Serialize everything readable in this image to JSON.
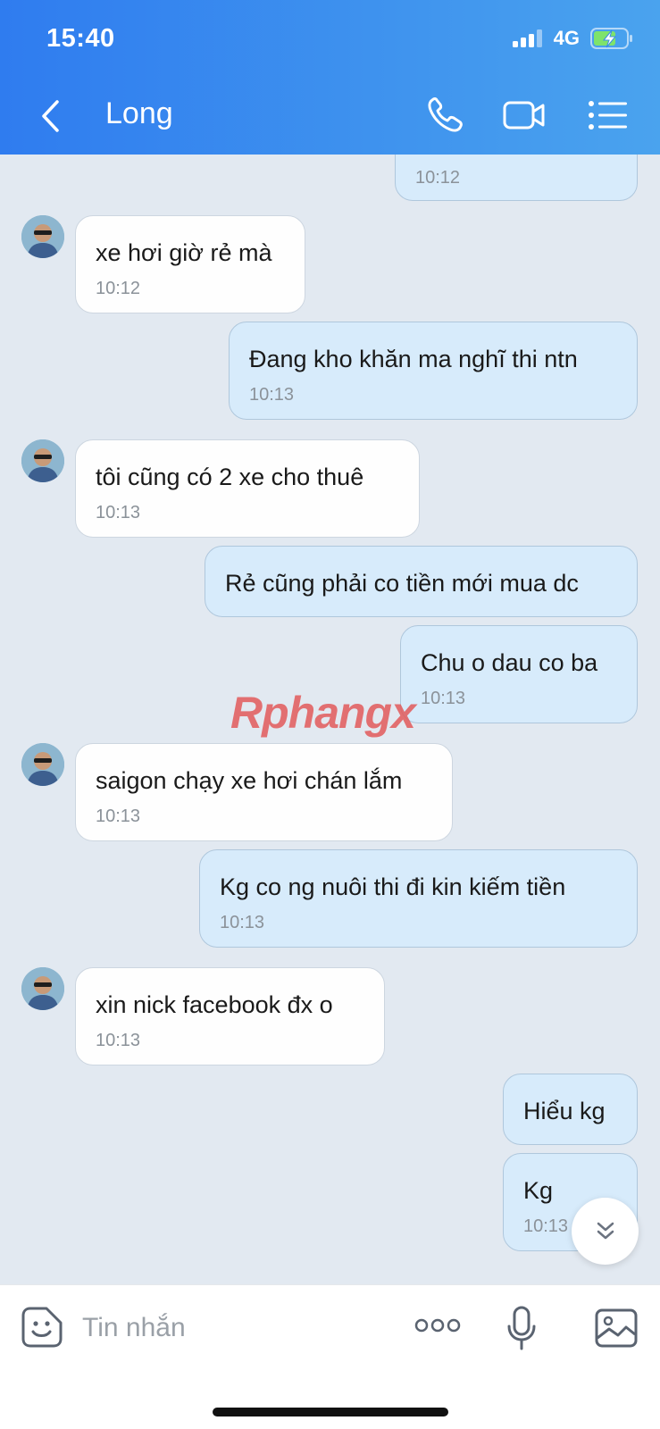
{
  "status_bar": {
    "time": "15:40",
    "network": "4G",
    "battery_icon": "battery-charging-icon",
    "signal_icon": "signal-bars-icon"
  },
  "header": {
    "title": "Long",
    "back_icon": "chevron-left-icon",
    "call_icon": "phone-icon",
    "video_icon": "video-camera-icon",
    "menu_icon": "list-menu-icon",
    "gradient_start": "#2f7cef",
    "gradient_end": "#4aa3ee"
  },
  "messages": [
    {
      "direction": "out",
      "text": "",
      "time": "10:12"
    },
    {
      "direction": "in",
      "text": "xe hơi giờ rẻ mà",
      "time": "10:12"
    },
    {
      "direction": "out",
      "text": "Đang kho khăn ma nghĩ thi ntn",
      "time": "10:13"
    },
    {
      "direction": "in",
      "text": "tôi cũng có 2 xe cho thuê",
      "time": "10:13"
    },
    {
      "direction": "out",
      "text": "Rẻ cũng phải co tiền mới mua dc",
      "time": ""
    },
    {
      "direction": "out",
      "text": "Chu o dau co ba",
      "time": "10:13"
    },
    {
      "direction": "in",
      "text": "saigon chạy xe hơi chán lắm",
      "time": "10:13"
    },
    {
      "direction": "out",
      "text": "Kg co ng nuôi thi đi kin kiếm tiền",
      "time": "10:13"
    },
    {
      "direction": "in",
      "text": "xin nick facebook đx o",
      "time": "10:13"
    },
    {
      "direction": "out",
      "text": "Hiểu kg",
      "time": ""
    },
    {
      "direction": "out",
      "text": "Kg",
      "time": "10:13"
    }
  ],
  "watermark": "Rphangx",
  "scroll_down_icon": "double-chevron-down-icon",
  "input_bar": {
    "placeholder": "Tin nhắn",
    "sticker_icon": "sticker-face-icon",
    "more_icon": "more-dots-icon",
    "mic_icon": "microphone-icon",
    "gallery_icon": "image-gallery-icon"
  },
  "colors": {
    "incoming_bubble": "#fefefe",
    "outgoing_bubble": "#d7ebfb",
    "chat_background": "#e2e9f1"
  }
}
